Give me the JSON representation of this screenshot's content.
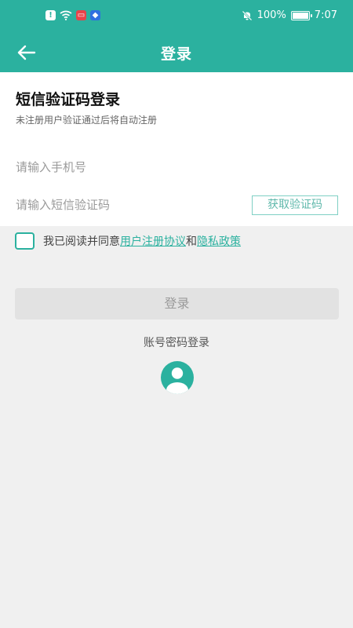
{
  "status_bar": {
    "battery_percent": "100%",
    "battery_level": 1,
    "time": "7:07",
    "icons": [
      "alert-icon",
      "wifi-icon",
      "message-icon",
      "app-icon",
      "bell-off-icon",
      "battery-icon"
    ]
  },
  "app_bar": {
    "title": "登录",
    "back_icon": "arrow-left-icon"
  },
  "form": {
    "heading": "短信验证码登录",
    "subheading": "未注册用户验证通过后将自动注册",
    "phone_placeholder": "请输入手机号",
    "phone_value": "",
    "code_placeholder": "请输入短信验证码",
    "code_value": "",
    "get_code_label": "获取验证码"
  },
  "agreement": {
    "prefix": "我已阅读并同意",
    "user_agreement": "用户注册协议",
    "conjunction": "和",
    "privacy_policy": "隐私政策"
  },
  "actions": {
    "login_label": "登录",
    "account_login_label": "账号密码登录",
    "account_icon": "user-avatar-icon"
  },
  "colors": {
    "accent": "#2bb19f",
    "background": "#f0f0f0",
    "disabled_button": "#e2e2e2"
  }
}
